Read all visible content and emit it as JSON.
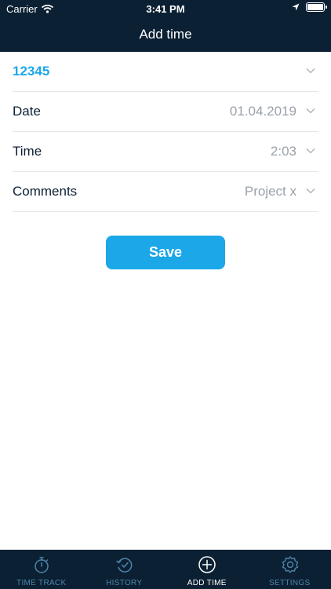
{
  "status_bar": {
    "carrier": "Carrier",
    "time": "3:41 PM"
  },
  "header": {
    "title": "Add time"
  },
  "form": {
    "project": {
      "label": "12345"
    },
    "date": {
      "label": "Date",
      "value": "01.04.2019"
    },
    "time": {
      "label": "Time",
      "value": "2:03"
    },
    "comments": {
      "label": "Comments",
      "placeholder": "Project x"
    }
  },
  "save_label": "Save",
  "tabs": [
    {
      "label": "TIME TRACK",
      "icon": "stopwatch-icon"
    },
    {
      "label": "HISTORY",
      "icon": "history-icon"
    },
    {
      "label": "ADD TIME",
      "icon": "add-circle-icon"
    },
    {
      "label": "SETTINGS",
      "icon": "gear-icon"
    }
  ],
  "colors": {
    "header": "#0b2033",
    "accent": "#1ba7e8",
    "tab_inactive": "#4f85a8"
  }
}
